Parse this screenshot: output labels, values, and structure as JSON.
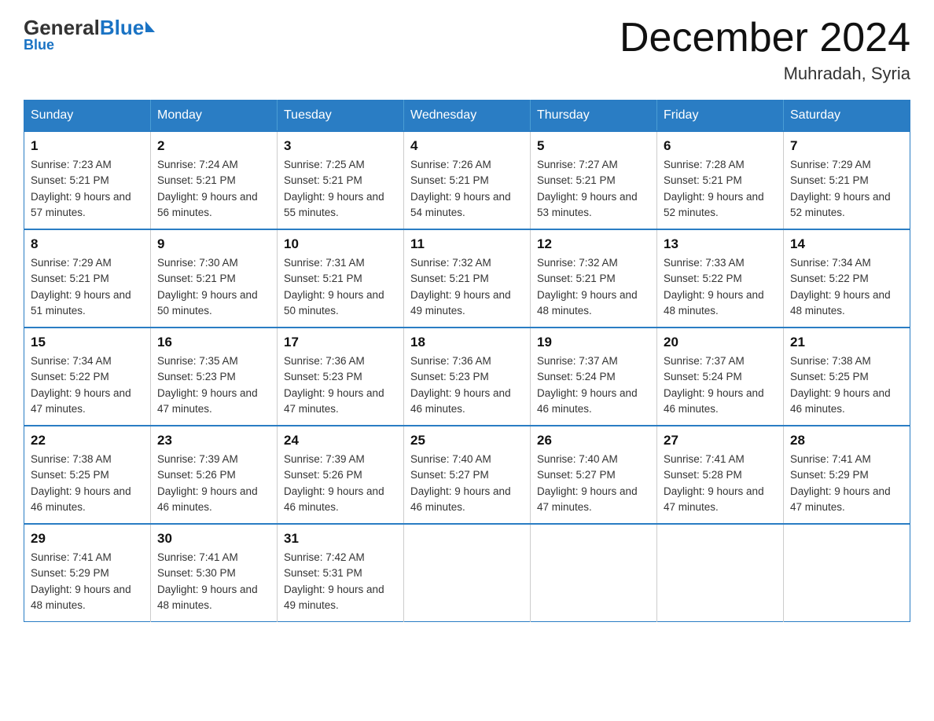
{
  "logo": {
    "general": "General",
    "blue": "Blue"
  },
  "title": "December 2024",
  "subtitle": "Muhradah, Syria",
  "weekdays": [
    "Sunday",
    "Monday",
    "Tuesday",
    "Wednesday",
    "Thursday",
    "Friday",
    "Saturday"
  ],
  "weeks": [
    [
      {
        "day": "1",
        "sunrise": "7:23 AM",
        "sunset": "5:21 PM",
        "daylight": "9 hours and 57 minutes."
      },
      {
        "day": "2",
        "sunrise": "7:24 AM",
        "sunset": "5:21 PM",
        "daylight": "9 hours and 56 minutes."
      },
      {
        "day": "3",
        "sunrise": "7:25 AM",
        "sunset": "5:21 PM",
        "daylight": "9 hours and 55 minutes."
      },
      {
        "day": "4",
        "sunrise": "7:26 AM",
        "sunset": "5:21 PM",
        "daylight": "9 hours and 54 minutes."
      },
      {
        "day": "5",
        "sunrise": "7:27 AM",
        "sunset": "5:21 PM",
        "daylight": "9 hours and 53 minutes."
      },
      {
        "day": "6",
        "sunrise": "7:28 AM",
        "sunset": "5:21 PM",
        "daylight": "9 hours and 52 minutes."
      },
      {
        "day": "7",
        "sunrise": "7:29 AM",
        "sunset": "5:21 PM",
        "daylight": "9 hours and 52 minutes."
      }
    ],
    [
      {
        "day": "8",
        "sunrise": "7:29 AM",
        "sunset": "5:21 PM",
        "daylight": "9 hours and 51 minutes."
      },
      {
        "day": "9",
        "sunrise": "7:30 AM",
        "sunset": "5:21 PM",
        "daylight": "9 hours and 50 minutes."
      },
      {
        "day": "10",
        "sunrise": "7:31 AM",
        "sunset": "5:21 PM",
        "daylight": "9 hours and 50 minutes."
      },
      {
        "day": "11",
        "sunrise": "7:32 AM",
        "sunset": "5:21 PM",
        "daylight": "9 hours and 49 minutes."
      },
      {
        "day": "12",
        "sunrise": "7:32 AM",
        "sunset": "5:21 PM",
        "daylight": "9 hours and 48 minutes."
      },
      {
        "day": "13",
        "sunrise": "7:33 AM",
        "sunset": "5:22 PM",
        "daylight": "9 hours and 48 minutes."
      },
      {
        "day": "14",
        "sunrise": "7:34 AM",
        "sunset": "5:22 PM",
        "daylight": "9 hours and 48 minutes."
      }
    ],
    [
      {
        "day": "15",
        "sunrise": "7:34 AM",
        "sunset": "5:22 PM",
        "daylight": "9 hours and 47 minutes."
      },
      {
        "day": "16",
        "sunrise": "7:35 AM",
        "sunset": "5:23 PM",
        "daylight": "9 hours and 47 minutes."
      },
      {
        "day": "17",
        "sunrise": "7:36 AM",
        "sunset": "5:23 PM",
        "daylight": "9 hours and 47 minutes."
      },
      {
        "day": "18",
        "sunrise": "7:36 AM",
        "sunset": "5:23 PM",
        "daylight": "9 hours and 46 minutes."
      },
      {
        "day": "19",
        "sunrise": "7:37 AM",
        "sunset": "5:24 PM",
        "daylight": "9 hours and 46 minutes."
      },
      {
        "day": "20",
        "sunrise": "7:37 AM",
        "sunset": "5:24 PM",
        "daylight": "9 hours and 46 minutes."
      },
      {
        "day": "21",
        "sunrise": "7:38 AM",
        "sunset": "5:25 PM",
        "daylight": "9 hours and 46 minutes."
      }
    ],
    [
      {
        "day": "22",
        "sunrise": "7:38 AM",
        "sunset": "5:25 PM",
        "daylight": "9 hours and 46 minutes."
      },
      {
        "day": "23",
        "sunrise": "7:39 AM",
        "sunset": "5:26 PM",
        "daylight": "9 hours and 46 minutes."
      },
      {
        "day": "24",
        "sunrise": "7:39 AM",
        "sunset": "5:26 PM",
        "daylight": "9 hours and 46 minutes."
      },
      {
        "day": "25",
        "sunrise": "7:40 AM",
        "sunset": "5:27 PM",
        "daylight": "9 hours and 46 minutes."
      },
      {
        "day": "26",
        "sunrise": "7:40 AM",
        "sunset": "5:27 PM",
        "daylight": "9 hours and 47 minutes."
      },
      {
        "day": "27",
        "sunrise": "7:41 AM",
        "sunset": "5:28 PM",
        "daylight": "9 hours and 47 minutes."
      },
      {
        "day": "28",
        "sunrise": "7:41 AM",
        "sunset": "5:29 PM",
        "daylight": "9 hours and 47 minutes."
      }
    ],
    [
      {
        "day": "29",
        "sunrise": "7:41 AM",
        "sunset": "5:29 PM",
        "daylight": "9 hours and 48 minutes."
      },
      {
        "day": "30",
        "sunrise": "7:41 AM",
        "sunset": "5:30 PM",
        "daylight": "9 hours and 48 minutes."
      },
      {
        "day": "31",
        "sunrise": "7:42 AM",
        "sunset": "5:31 PM",
        "daylight": "9 hours and 49 minutes."
      },
      null,
      null,
      null,
      null
    ]
  ]
}
